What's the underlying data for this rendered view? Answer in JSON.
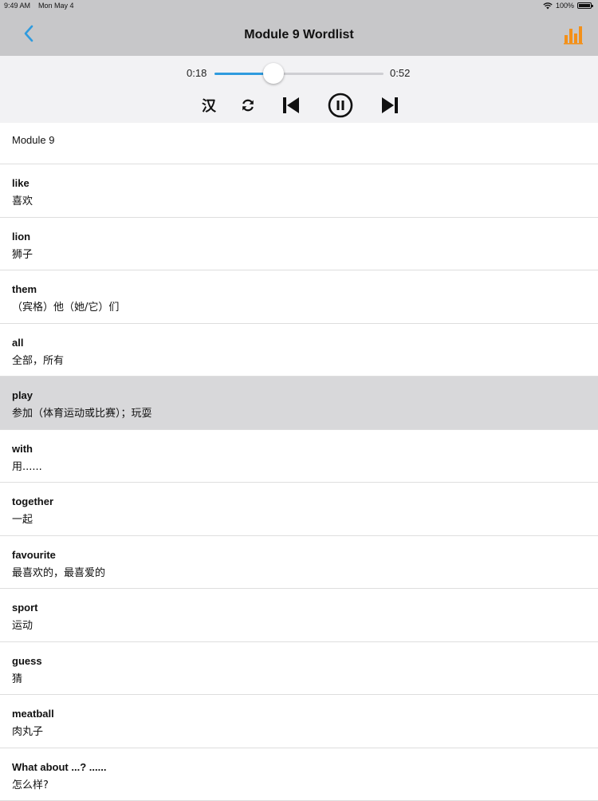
{
  "status_bar": {
    "time": "9:49 AM",
    "date": "Mon May 4",
    "battery": "100%"
  },
  "nav": {
    "title": "Module 9  Wordlist"
  },
  "player": {
    "current_time": "0:18",
    "total_time": "0:52",
    "progress": 0.35,
    "chinese_toggle_label": "汉",
    "accent_color": "#2f9bde"
  },
  "list": {
    "header": "Module 9",
    "selected_index": 4,
    "items": [
      {
        "word": "like",
        "meaning": "喜欢"
      },
      {
        "word": "lion",
        "meaning": "狮子"
      },
      {
        "word": "them",
        "meaning": "（宾格）他（她/它）们"
      },
      {
        "word": "all",
        "meaning": "全部，所有"
      },
      {
        "word": "play",
        "meaning": "参加（体育运动或比赛）；玩耍"
      },
      {
        "word": "with",
        "meaning": "用......"
      },
      {
        "word": "together",
        "meaning": "一起"
      },
      {
        "word": "favourite",
        "meaning": "最喜欢的，最喜爱的"
      },
      {
        "word": "sport",
        "meaning": "运动"
      },
      {
        "word": "guess",
        "meaning": "猜"
      },
      {
        "word": "meatball",
        "meaning": "肉丸子"
      },
      {
        "word": "What about ...? ......",
        "meaning": "怎么样?"
      }
    ]
  },
  "icons": {
    "back": "chevron-left-icon",
    "stats": "bar-chart-icon",
    "repeat": "repeat-icon",
    "prev": "skip-previous-icon",
    "pause": "pause-circle-icon",
    "next": "skip-next-icon",
    "wifi": "wifi-icon",
    "battery": "battery-icon"
  },
  "colors": {
    "back_icon": "#2f9bde",
    "stats_icon": "#f39019"
  }
}
